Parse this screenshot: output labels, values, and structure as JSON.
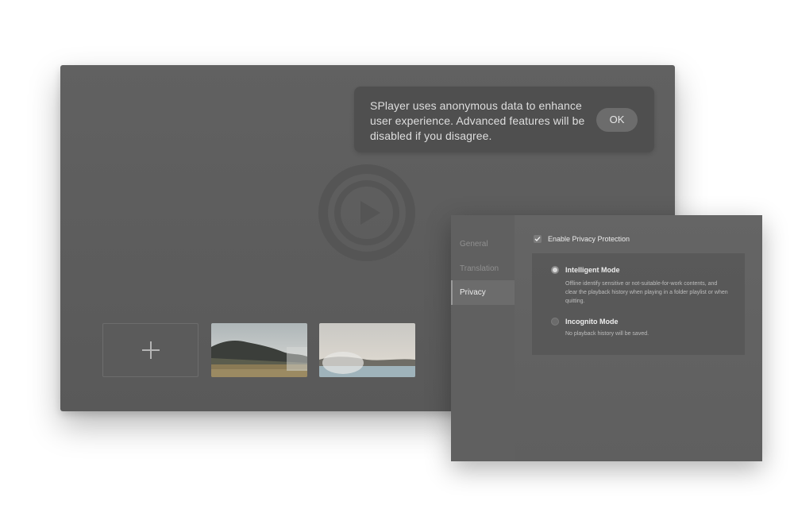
{
  "main": {
    "notice_text": "SPlayer uses anonymous data to enhance user experience. Advanced features will be disabled if you disagree.",
    "ok_label": "OK"
  },
  "icons": {
    "play": "play-circle-icon",
    "add": "plus-icon",
    "check": "checkmark-icon"
  },
  "preferences": {
    "sidebar": [
      {
        "label": "General",
        "active": false
      },
      {
        "label": "Translation",
        "active": false
      },
      {
        "label": "Privacy",
        "active": true
      }
    ],
    "enable_privacy_label": "Enable Privacy Protection",
    "enable_privacy_checked": true,
    "modes": [
      {
        "title": "Intelligent Mode",
        "description": "Offline identify sensitive or not-suitable-for-work contents, and clear the playback history when playing in a folder playlist or when quitting.",
        "selected": true
      },
      {
        "title": "Incognito Mode",
        "description": "No playback history will be saved.",
        "selected": false
      }
    ]
  },
  "colors": {
    "window_bg": "#5e5e5e",
    "text_primary": "#ececec",
    "text_dim": "#8f8f8f"
  }
}
